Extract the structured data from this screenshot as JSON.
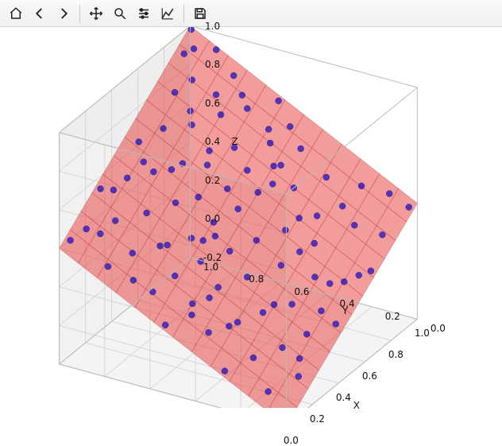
{
  "toolbar": {
    "home": "Home",
    "back": "Back",
    "forward": "Forward",
    "pan": "Pan",
    "zoom": "Zoom",
    "subplots": "Configure subplots",
    "edit": "Edit axis/curve params",
    "save": "Save"
  },
  "chart_data": {
    "type": "scatter3d_with_surface",
    "xlabel": "X",
    "ylabel": "Y",
    "zlabel": "Z",
    "xlim": [
      0.0,
      1.0
    ],
    "ylim": [
      0.0,
      1.0
    ],
    "zlim": [
      -0.2,
      1.0
    ],
    "xticks": [
      0.0,
      0.2,
      0.4,
      0.6,
      0.8,
      1.0
    ],
    "yticks": [
      0.0,
      0.2,
      0.4,
      0.6,
      0.8,
      1.0
    ],
    "zticks": [
      -0.2,
      0.0,
      0.2,
      0.4,
      0.6,
      0.8,
      1.0
    ],
    "surface": {
      "description": "approx. plane z = -0.2 + 0.6*x + 0.6*y",
      "corners": [
        {
          "x": 0,
          "y": 0,
          "z": -0.2
        },
        {
          "x": 1,
          "y": 0,
          "z": 0.4
        },
        {
          "x": 1,
          "y": 1,
          "z": 1.0
        },
        {
          "x": 0,
          "y": 1,
          "z": 0.4
        }
      ],
      "color": "#e84a4a",
      "alpha": 0.55
    },
    "scatter_color": "#1f10c4",
    "scatter_alpha": 0.75,
    "points": [
      {
        "x": 0.03,
        "y": 0.55,
        "z": 0.13
      },
      {
        "x": 0.05,
        "y": 0.3,
        "z": -0.04
      },
      {
        "x": 0.06,
        "y": 0.82,
        "z": 0.33
      },
      {
        "x": 0.07,
        "y": 0.12,
        "z": -0.1
      },
      {
        "x": 0.09,
        "y": 0.64,
        "z": 0.24
      },
      {
        "x": 0.1,
        "y": 0.4,
        "z": 0.1
      },
      {
        "x": 0.12,
        "y": 0.95,
        "z": 0.45
      },
      {
        "x": 0.13,
        "y": 0.22,
        "z": 0.01
      },
      {
        "x": 0.15,
        "y": 0.5,
        "z": 0.19
      },
      {
        "x": 0.16,
        "y": 0.77,
        "z": 0.36
      },
      {
        "x": 0.18,
        "y": 0.05,
        "z": -0.06
      },
      {
        "x": 0.19,
        "y": 0.6,
        "z": 0.28
      },
      {
        "x": 0.2,
        "y": 0.33,
        "z": 0.12
      },
      {
        "x": 0.22,
        "y": 0.88,
        "z": 0.46
      },
      {
        "x": 0.23,
        "y": 0.15,
        "z": 0.03
      },
      {
        "x": 0.25,
        "y": 0.7,
        "z": 0.37
      },
      {
        "x": 0.26,
        "y": 0.45,
        "z": 0.23
      },
      {
        "x": 0.28,
        "y": 0.98,
        "z": 0.56
      },
      {
        "x": 0.29,
        "y": 0.27,
        "z": 0.14
      },
      {
        "x": 0.3,
        "y": 0.55,
        "z": 0.31
      },
      {
        "x": 0.32,
        "y": 0.8,
        "z": 0.47
      },
      {
        "x": 0.33,
        "y": 0.1,
        "z": 0.06
      },
      {
        "x": 0.35,
        "y": 0.62,
        "z": 0.38
      },
      {
        "x": 0.36,
        "y": 0.38,
        "z": 0.25
      },
      {
        "x": 0.38,
        "y": 0.92,
        "z": 0.58
      },
      {
        "x": 0.39,
        "y": 0.2,
        "z": 0.15
      },
      {
        "x": 0.4,
        "y": 0.48,
        "z": 0.33
      },
      {
        "x": 0.42,
        "y": 0.73,
        "z": 0.49
      },
      {
        "x": 0.43,
        "y": 0.03,
        "z": 0.08
      },
      {
        "x": 0.45,
        "y": 0.58,
        "z": 0.42
      },
      {
        "x": 0.46,
        "y": 0.85,
        "z": 0.59
      },
      {
        "x": 0.48,
        "y": 0.3,
        "z": 0.27
      },
      {
        "x": 0.49,
        "y": 0.67,
        "z": 0.5
      },
      {
        "x": 0.5,
        "y": 0.42,
        "z": 0.35
      },
      {
        "x": 0.52,
        "y": 0.95,
        "z": 0.68
      },
      {
        "x": 0.53,
        "y": 0.18,
        "z": 0.22
      },
      {
        "x": 0.55,
        "y": 0.53,
        "z": 0.45
      },
      {
        "x": 0.56,
        "y": 0.78,
        "z": 0.6
      },
      {
        "x": 0.58,
        "y": 0.08,
        "z": 0.2
      },
      {
        "x": 0.59,
        "y": 0.6,
        "z": 0.51
      },
      {
        "x": 0.6,
        "y": 0.35,
        "z": 0.37
      },
      {
        "x": 0.62,
        "y": 0.9,
        "z": 0.71
      },
      {
        "x": 0.63,
        "y": 0.24,
        "z": 0.32
      },
      {
        "x": 0.65,
        "y": 0.5,
        "z": 0.49
      },
      {
        "x": 0.66,
        "y": 0.72,
        "z": 0.63
      },
      {
        "x": 0.68,
        "y": 0.02,
        "z": 0.22
      },
      {
        "x": 0.69,
        "y": 0.57,
        "z": 0.56
      },
      {
        "x": 0.7,
        "y": 0.82,
        "z": 0.71
      },
      {
        "x": 0.72,
        "y": 0.28,
        "z": 0.4
      },
      {
        "x": 0.73,
        "y": 0.65,
        "z": 0.63
      },
      {
        "x": 0.75,
        "y": 0.4,
        "z": 0.49
      },
      {
        "x": 0.76,
        "y": 0.93,
        "z": 0.81
      },
      {
        "x": 0.78,
        "y": 0.15,
        "z": 0.36
      },
      {
        "x": 0.79,
        "y": 0.48,
        "z": 0.56
      },
      {
        "x": 0.8,
        "y": 0.75,
        "z": 0.73
      },
      {
        "x": 0.82,
        "y": 0.05,
        "z": 0.32
      },
      {
        "x": 0.83,
        "y": 0.55,
        "z": 0.63
      },
      {
        "x": 0.85,
        "y": 0.8,
        "z": 0.79
      },
      {
        "x": 0.86,
        "y": 0.32,
        "z": 0.51
      },
      {
        "x": 0.88,
        "y": 0.68,
        "z": 0.74
      },
      {
        "x": 0.89,
        "y": 0.45,
        "z": 0.6
      },
      {
        "x": 0.9,
        "y": 0.97,
        "z": 0.92
      },
      {
        "x": 0.92,
        "y": 0.2,
        "z": 0.47
      },
      {
        "x": 0.93,
        "y": 0.52,
        "z": 0.67
      },
      {
        "x": 0.95,
        "y": 0.78,
        "z": 0.84
      },
      {
        "x": 0.96,
        "y": 0.1,
        "z": 0.44
      },
      {
        "x": 0.98,
        "y": 0.6,
        "z": 0.75
      },
      {
        "x": 0.99,
        "y": 0.88,
        "z": 0.92
      },
      {
        "x": 0.14,
        "y": 0.9,
        "z": 0.43
      },
      {
        "x": 0.21,
        "y": 0.46,
        "z": 0.2
      },
      {
        "x": 0.27,
        "y": 0.68,
        "z": 0.37
      },
      {
        "x": 0.34,
        "y": 0.25,
        "z": 0.16
      },
      {
        "x": 0.41,
        "y": 0.55,
        "z": 0.38
      },
      {
        "x": 0.47,
        "y": 0.9,
        "z": 0.62
      },
      {
        "x": 0.54,
        "y": 0.12,
        "z": 0.2
      },
      {
        "x": 0.61,
        "y": 0.7,
        "z": 0.59
      },
      {
        "x": 0.67,
        "y": 0.33,
        "z": 0.4
      },
      {
        "x": 0.74,
        "y": 0.85,
        "z": 0.75
      },
      {
        "x": 0.81,
        "y": 0.22,
        "z": 0.42
      },
      {
        "x": 0.87,
        "y": 0.58,
        "z": 0.67
      },
      {
        "x": 0.94,
        "y": 0.95,
        "z": 0.93
      },
      {
        "x": 0.02,
        "y": 0.02,
        "z": -0.19
      },
      {
        "x": 0.05,
        "y": 0.98,
        "z": 0.42
      },
      {
        "x": 0.97,
        "y": 0.02,
        "z": 0.39
      },
      {
        "x": 0.44,
        "y": 0.1,
        "z": 0.12
      },
      {
        "x": 0.11,
        "y": 0.48,
        "z": 0.16
      },
      {
        "x": 0.31,
        "y": 0.94,
        "z": 0.55
      },
      {
        "x": 0.57,
        "y": 0.27,
        "z": 0.3
      },
      {
        "x": 0.71,
        "y": 0.47,
        "z": 0.51
      },
      {
        "x": 0.84,
        "y": 0.9,
        "z": 0.84
      },
      {
        "x": 0.17,
        "y": 0.35,
        "z": 0.11
      },
      {
        "x": 0.37,
        "y": 0.58,
        "z": 0.37
      },
      {
        "x": 0.51,
        "y": 0.8,
        "z": 0.59
      },
      {
        "x": 0.64,
        "y": 0.05,
        "z": 0.21
      },
      {
        "x": 0.77,
        "y": 0.5,
        "z": 0.56
      },
      {
        "x": 0.91,
        "y": 0.72,
        "z": 0.78
      },
      {
        "x": 0.24,
        "y": 0.08,
        "z": -0.01
      },
      {
        "x": 0.08,
        "y": 0.72,
        "z": 0.28
      },
      {
        "x": 0.99,
        "y": 0.99,
        "z": 0.99
      }
    ]
  }
}
